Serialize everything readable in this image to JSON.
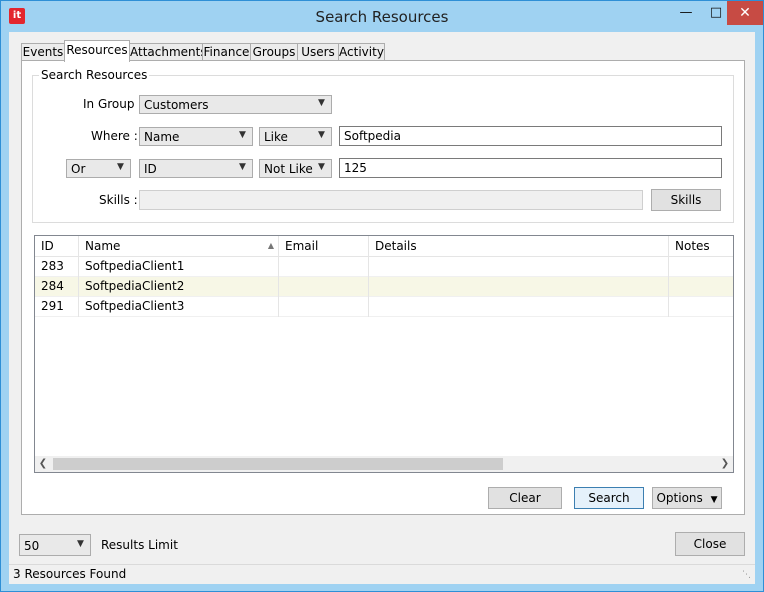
{
  "window": {
    "title": "Search Resources",
    "icon": "it"
  },
  "tabs": [
    "Events",
    "Resources",
    "Attachments",
    "Finance",
    "Groups",
    "Users",
    "Activity"
  ],
  "group": {
    "title": "Search Resources",
    "in_group_label": "In Group :",
    "in_group_value": "Customers",
    "where_label": "Where :",
    "where_field": "Name",
    "where_op": "Like",
    "where_value": "Softpedia",
    "conj": "Or",
    "field2": "ID",
    "op2": "Not Like",
    "value2": "125",
    "skills_label": "Skills :",
    "skills_value": "",
    "skills_button": "Skills"
  },
  "grid": {
    "columns": [
      "ID",
      "Name",
      "Email",
      "Details",
      "Notes"
    ],
    "rows": [
      [
        "283",
        "SoftpediaClient1",
        "",
        "",
        ""
      ],
      [
        "284",
        "SoftpediaClient2",
        "",
        "",
        ""
      ],
      [
        "291",
        "SoftpediaClient3",
        "",
        "",
        ""
      ]
    ]
  },
  "buttons": {
    "clear": "Clear",
    "search": "Search",
    "options": "Options",
    "close": "Close"
  },
  "limit": {
    "value": "50",
    "label": "Results Limit"
  },
  "status": "3 Resources Found"
}
